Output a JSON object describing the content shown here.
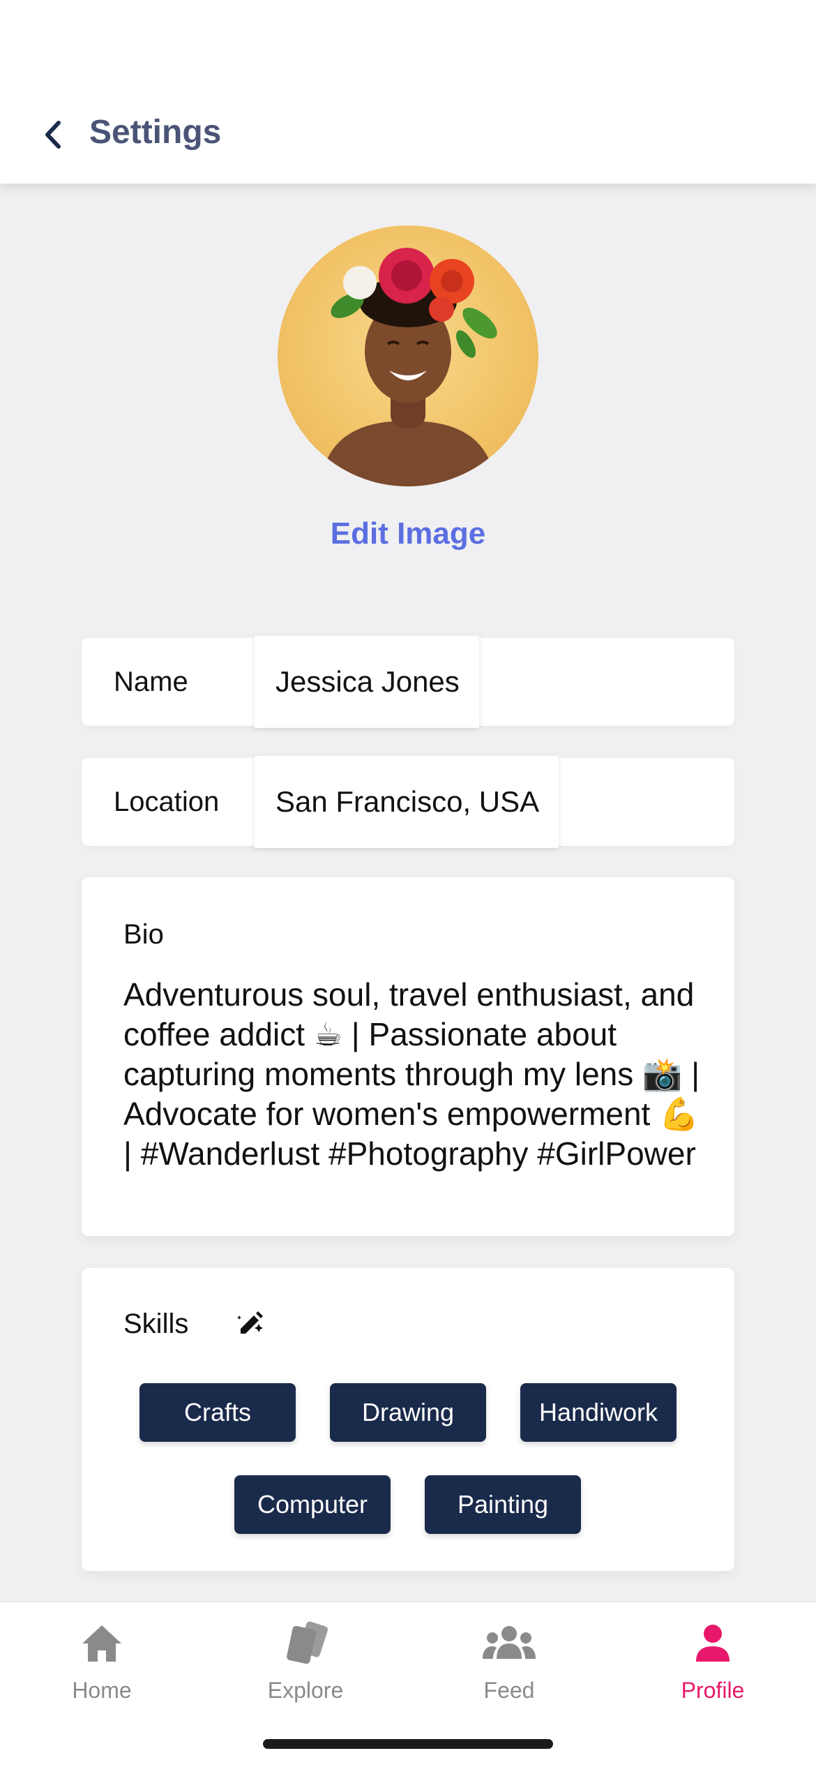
{
  "header": {
    "title": "Settings",
    "back_icon": "chevron-left-icon"
  },
  "profile": {
    "edit_image_label": "Edit Image",
    "avatar_icon": "avatar"
  },
  "fields": {
    "name": {
      "label": "Name",
      "value": "Jessica Jones"
    },
    "location": {
      "label": "Location",
      "value": "San Francisco, USA"
    }
  },
  "bio": {
    "label": "Bio",
    "text": "Adventurous soul, travel enthusiast, and coffee addict ☕ | Passionate about capturing moments through my lens 📸 | Advocate for women's empowerment 💪 | #Wanderlust #Photography #GirlPower"
  },
  "skills": {
    "label": "Skills",
    "edit_icon": "pencil-icon",
    "items": [
      "Crafts",
      "Drawing",
      "Handiwork",
      "Computer",
      "Painting"
    ]
  },
  "tabbar": {
    "items": [
      {
        "label": "Home",
        "icon": "home-icon",
        "active": false
      },
      {
        "label": "Explore",
        "icon": "cards-icon",
        "active": false
      },
      {
        "label": "Feed",
        "icon": "people-icon",
        "active": false
      },
      {
        "label": "Profile",
        "icon": "person-icon",
        "active": true
      }
    ]
  },
  "colors": {
    "accent": "#5b6ee1",
    "title": "#4a5477",
    "chip": "#1a2a4a",
    "active_tab": "#e8196a",
    "inactive_tab": "#8a8a8a",
    "background": "#f0f0f2"
  }
}
